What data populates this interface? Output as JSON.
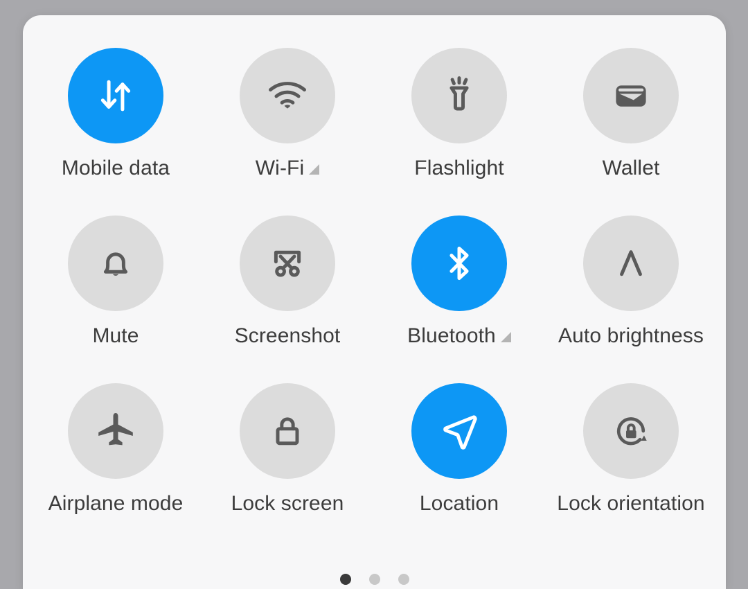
{
  "panel": {
    "name": "Quick settings panel",
    "background_color": "#f7f7f8",
    "backdrop_color": "#a8a8ac",
    "active_tile_color": "#0d97f5",
    "inactive_tile_color": "#dcdcdc",
    "icon_color": "#5a5a5a",
    "label_color": "#3c3c3c"
  },
  "tiles": [
    {
      "label": "Mobile data",
      "icon": "mobile-data-icon",
      "state": "on",
      "expandable": false
    },
    {
      "label": "Wi-Fi",
      "icon": "wifi-icon",
      "state": "off",
      "expandable": true
    },
    {
      "label": "Flashlight",
      "icon": "flashlight-icon",
      "state": "off",
      "expandable": false
    },
    {
      "label": "Wallet",
      "icon": "wallet-icon",
      "state": "off",
      "expandable": false
    },
    {
      "label": "Mute",
      "icon": "bell-icon",
      "state": "off",
      "expandable": false
    },
    {
      "label": "Screenshot",
      "icon": "screenshot-icon",
      "state": "off",
      "expandable": false
    },
    {
      "label": "Bluetooth",
      "icon": "bluetooth-icon",
      "state": "on",
      "expandable": true
    },
    {
      "label": "Auto brightness",
      "icon": "auto-brightness-icon",
      "state": "off",
      "expandable": false
    },
    {
      "label": "Airplane mode",
      "icon": "airplane-icon",
      "state": "off",
      "expandable": false
    },
    {
      "label": "Lock screen",
      "icon": "lock-icon",
      "state": "off",
      "expandable": false
    },
    {
      "label": "Location",
      "icon": "location-arrow-icon",
      "state": "on",
      "expandable": false
    },
    {
      "label": "Lock orientation",
      "icon": "lock-orientation-icon",
      "state": "off",
      "expandable": false
    }
  ],
  "pagination": {
    "total_pages": 3,
    "current_page": 1
  }
}
